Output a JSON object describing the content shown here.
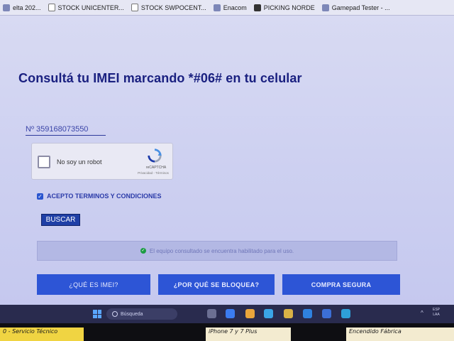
{
  "bookmarks": [
    {
      "label": "elta 202...",
      "icon": "bookmark-icon"
    },
    {
      "label": "STOCK UNICENTER...",
      "icon": "file-icon"
    },
    {
      "label": "STOCK SWPOCENT...",
      "icon": "file-icon"
    },
    {
      "label": "Enacom",
      "icon": "enacom-icon"
    },
    {
      "label": "PICKING NORDE",
      "icon": "x-icon"
    },
    {
      "label": "Gamepad Tester - ...",
      "icon": "gamepad-icon"
    }
  ],
  "page": {
    "title": "Consultá tu IMEI marcando *#06# en tu celular",
    "imei_value": "Nº 359168073550",
    "recaptcha": {
      "label": "No soy un robot",
      "brand": "reCAPTCHA",
      "terms": "Privacidad - Términos"
    },
    "terms_label": "ACEPTO TERMINOS Y CONDICIONES",
    "terms_checked": true,
    "search_button": "BUSCAR",
    "status_message": "El equipo consultado se encuentra habilitado para el uso.",
    "status_color": "#1c9c43",
    "nav_buttons": [
      "¿QUÉ ES IMEI?",
      "¿POR QUÉ SE BLOQUEA?",
      "COMPRA SEGURA"
    ],
    "accent_color": "#2d55d6"
  },
  "taskbar": {
    "search_placeholder": "Búsqueda",
    "tray_lang": "ESP",
    "tray_region": "LAA"
  },
  "stickers": [
    "0 - Servicio Técnico",
    "iPhone 7 y 7 Plus",
    "Encendido Fábrica"
  ]
}
